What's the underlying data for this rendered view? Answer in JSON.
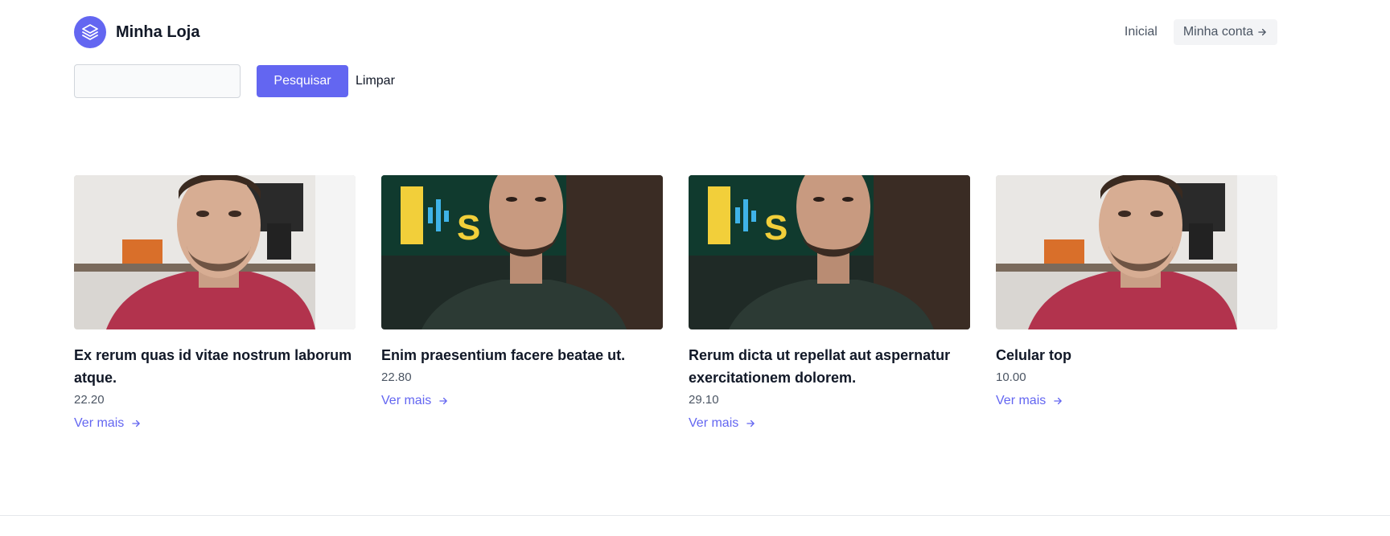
{
  "header": {
    "brand": "Minha Loja",
    "nav": {
      "home": "Inicial",
      "account": "Minha conta"
    }
  },
  "search": {
    "value": "",
    "placeholder": "",
    "button_label": "Pesquisar",
    "clear_label": "Limpar"
  },
  "colors": {
    "accent": "#6366f1",
    "text": "#111827",
    "muted": "#4b5563"
  },
  "products": [
    {
      "title": "Ex rerum quas id vitae nostrum laborum atque.",
      "price": "22.20",
      "link": "Ver mais",
      "photo": "man-red-hoodie"
    },
    {
      "title": "Enim praesentium facere beatae ut.",
      "price": "22.80",
      "link": "Ver mais",
      "photo": "man-dark-tshirt"
    },
    {
      "title": "Rerum dicta ut repellat aut aspernatur exercitationem dolorem.",
      "price": "29.10",
      "link": "Ver mais",
      "photo": "man-dark-tshirt"
    },
    {
      "title": "Celular top",
      "price": "10.00",
      "link": "Ver mais",
      "photo": "man-red-hoodie"
    }
  ]
}
